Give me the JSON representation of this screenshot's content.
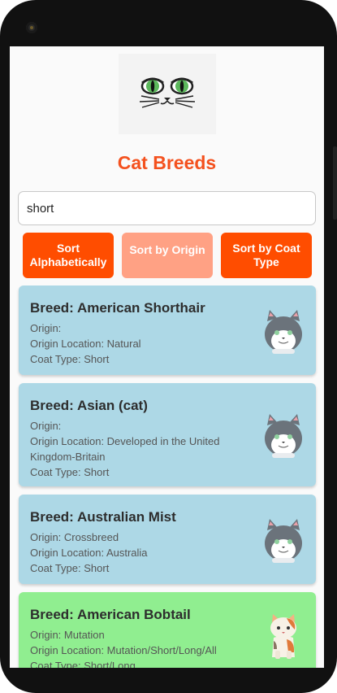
{
  "app": {
    "title": "Cat Breeds"
  },
  "search": {
    "value": "short",
    "placeholder": ""
  },
  "buttons": {
    "sort_alpha": "Sort Alphabetically",
    "sort_origin": "Sort by Origin",
    "sort_coat": "Sort by Coat Type"
  },
  "cards": [
    {
      "breed": "Breed: American Shorthair",
      "origin": "Origin:",
      "origin_location": "Origin Location: Natural",
      "coat_type": "Coat Type: Short",
      "icon": "gray-cat-icon",
      "color": "#add8e6"
    },
    {
      "breed": "Breed: Asian (cat)",
      "origin": "Origin:",
      "origin_location": "Origin Location: Developed in the United Kingdom-Britain",
      "coat_type": "Coat Type: Short",
      "icon": "gray-cat-icon",
      "color": "#add8e6"
    },
    {
      "breed": "Breed: Australian Mist",
      "origin": "Origin: Crossbreed",
      "origin_location": "Origin Location: Australia",
      "coat_type": "Coat Type: Short",
      "icon": "gray-cat-icon",
      "color": "#add8e6"
    },
    {
      "breed": "Breed: American Bobtail",
      "origin": "Origin: Mutation",
      "origin_location": "Origin Location: Mutation/Short/Long/All",
      "coat_type": "Coat Type: Short/Long",
      "icon": "calico-cat-icon",
      "color": "#90ee90"
    }
  ],
  "colors": {
    "accent": "#f4511e",
    "button": "#ff4d00",
    "button_active": "#ffa184"
  }
}
